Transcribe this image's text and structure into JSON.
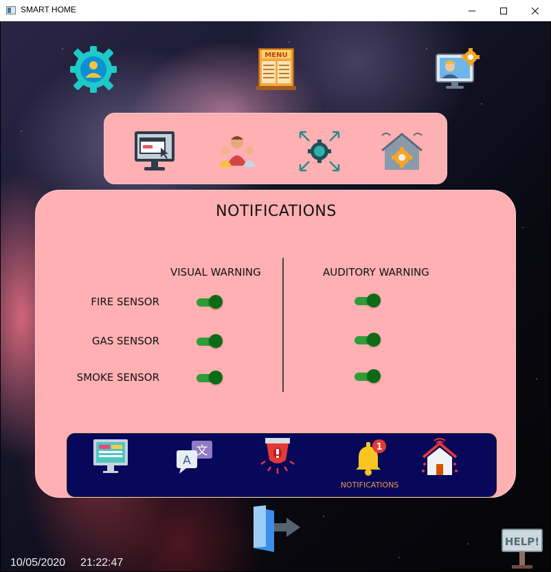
{
  "window": {
    "title": "SMART HOME"
  },
  "icons": {
    "profile": "user-gear-icon",
    "menu": "menu-board-icon",
    "engineer": "engineer-monitor-icon",
    "toolbar": [
      "monitor-window-icon",
      "users-group-icon",
      "expand-gear-icon",
      "smart-home-gear-icon"
    ],
    "nav": [
      "monitor-dashboard-icon",
      "translate-icon",
      "alarm-icon",
      "notification-bell-icon",
      "smart-home-icon"
    ],
    "exit": "exit-door-icon",
    "help": "help-sign-icon"
  },
  "notifications": {
    "title": "NOTIFICATIONS",
    "visual_header": "VISUAL WARNING",
    "auditory_header": "AUDITORY WARNING",
    "sensors": [
      {
        "label": "FIRE SENSOR",
        "visual": true,
        "auditory": true
      },
      {
        "label": "GAS SENSOR",
        "visual": true,
        "auditory": true
      },
      {
        "label": "SMOKE SENSOR",
        "visual": true,
        "auditory": true
      }
    ]
  },
  "nav": {
    "active_label": "NOTIFICATIONS",
    "badge_count": "1"
  },
  "status": {
    "date": "10/05/2020",
    "time": "21:22:47"
  },
  "help": {
    "label": "HELP!"
  },
  "colors": {
    "panel": "#ffb0b2",
    "nav_bg": "#07085a",
    "toggle_on": "#0c6b14",
    "active_label": "#e89a4e"
  }
}
